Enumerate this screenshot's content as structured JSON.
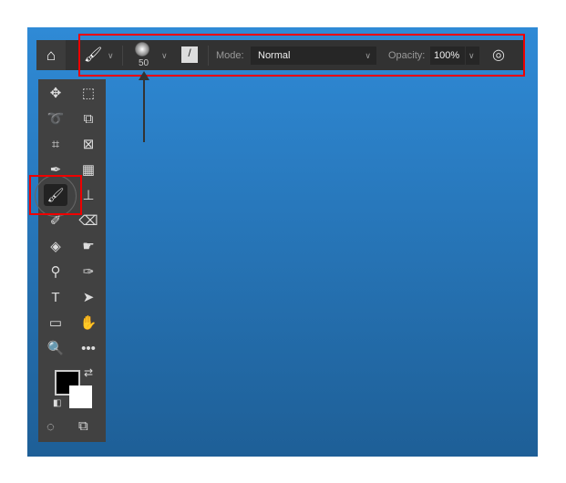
{
  "options_bar": {
    "home_icon": "home-icon",
    "brush_icon": "brush-icon",
    "brush_size": "50",
    "mode_label": "Mode:",
    "mode_value": "Normal",
    "opacity_label": "Opacity:",
    "opacity_value": "100%",
    "airbrush_icon": "airbrush-icon"
  },
  "toolbar": {
    "tools": [
      {
        "name": "move-tool",
        "glyph": "✥"
      },
      {
        "name": "marquee-tool",
        "glyph": "⬚"
      },
      {
        "name": "lasso-tool",
        "glyph": "➰"
      },
      {
        "name": "object-select-tool",
        "glyph": "⧉"
      },
      {
        "name": "crop-tool",
        "glyph": "⌗"
      },
      {
        "name": "frame-tool",
        "glyph": "⊠"
      },
      {
        "name": "eyedropper-tool",
        "glyph": "✒"
      },
      {
        "name": "patch-tool",
        "glyph": "▦"
      },
      {
        "name": "brush-tool",
        "glyph": "🖌"
      },
      {
        "name": "stamp-tool",
        "glyph": "⊥"
      },
      {
        "name": "history-brush-tool",
        "glyph": "✐"
      },
      {
        "name": "eraser-tool",
        "glyph": "⌫"
      },
      {
        "name": "paint-bucket-tool",
        "glyph": "◈"
      },
      {
        "name": "smudge-tool",
        "glyph": "☛"
      },
      {
        "name": "dodge-tool",
        "glyph": "⚲"
      },
      {
        "name": "pen-tool",
        "glyph": "✑"
      },
      {
        "name": "type-tool",
        "glyph": "T"
      },
      {
        "name": "path-select-tool",
        "glyph": "➤"
      },
      {
        "name": "rectangle-tool",
        "glyph": "▭"
      },
      {
        "name": "hand-tool",
        "glyph": "✋"
      },
      {
        "name": "zoom-tool",
        "glyph": "🔍"
      },
      {
        "name": "more-tools",
        "glyph": "•••"
      }
    ],
    "foreground_color": "#000000",
    "background_color": "#ffffff"
  },
  "colors": {
    "highlight": "#e00000",
    "panel": "#323232"
  }
}
